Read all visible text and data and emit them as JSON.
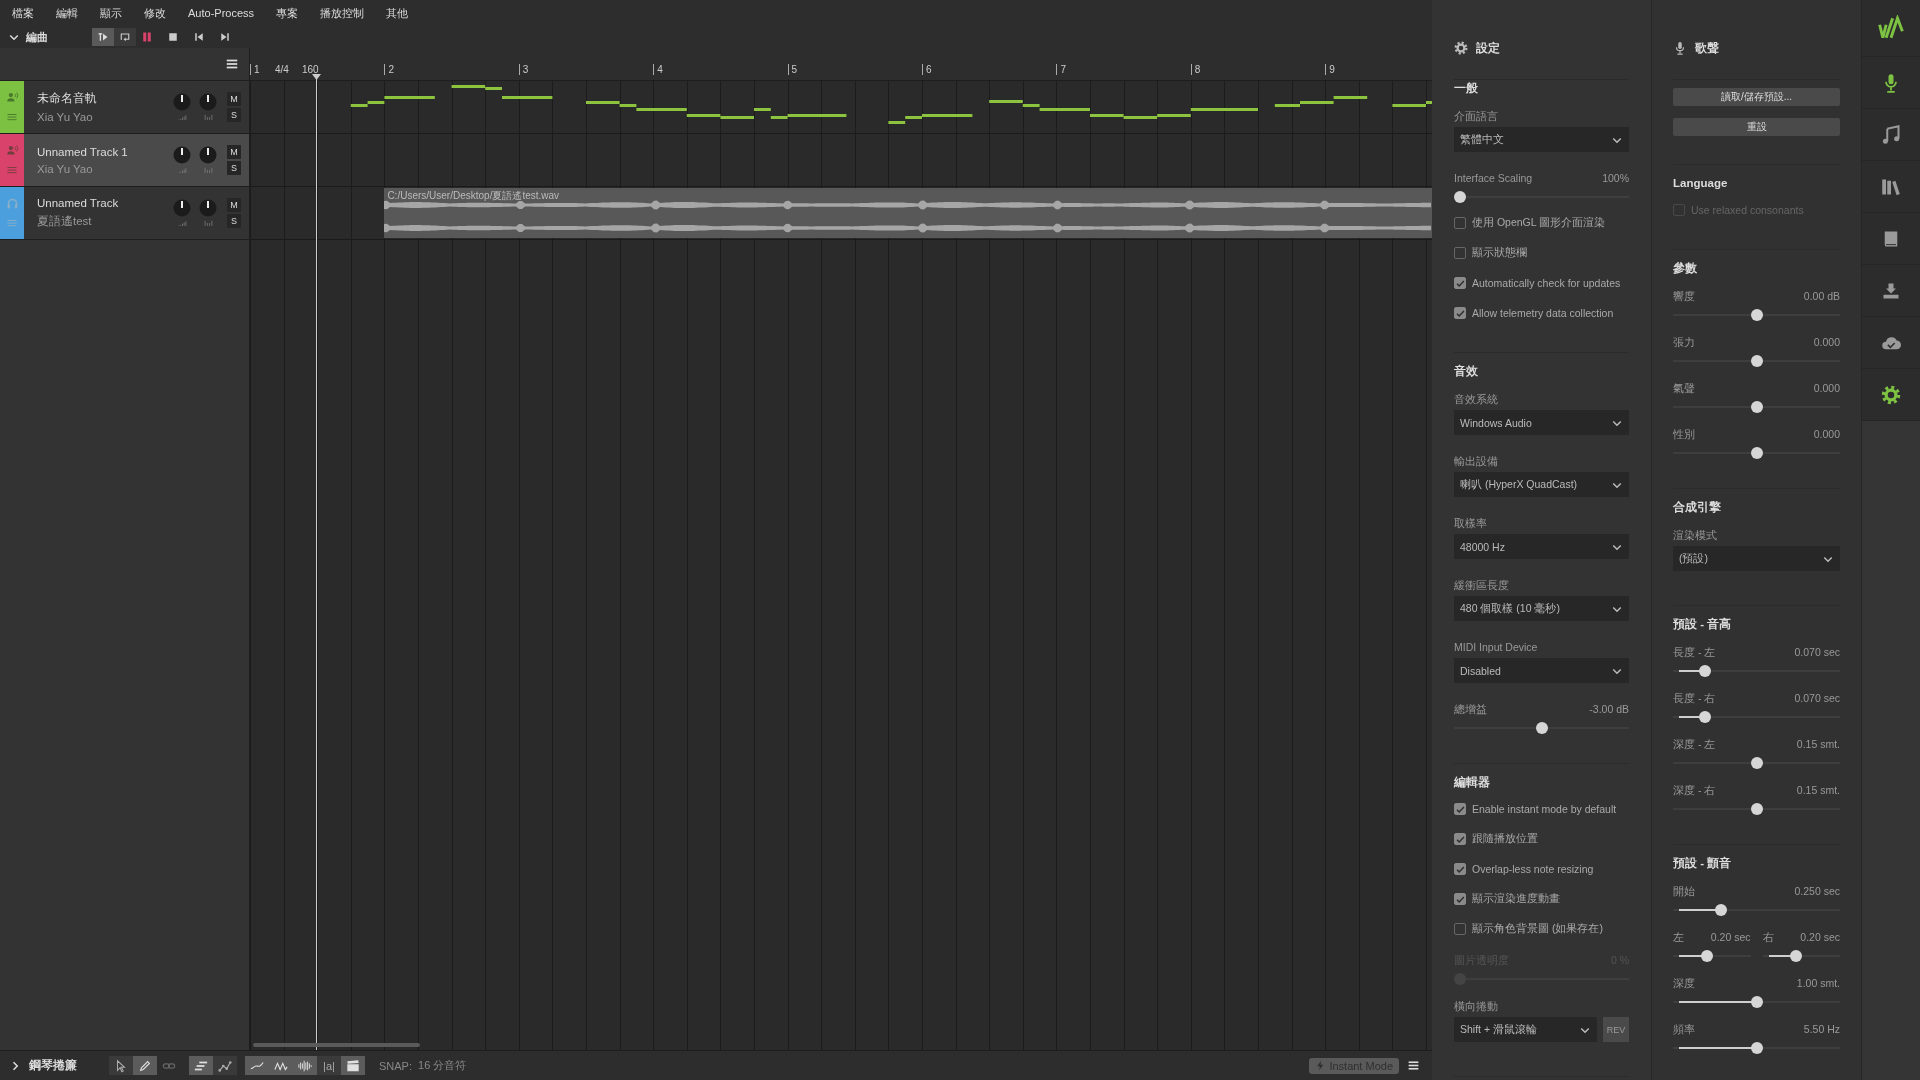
{
  "menu": [
    "檔案",
    "編輯",
    "顯示",
    "修改",
    "Auto-Process",
    "專案",
    "播放控制",
    "其他"
  ],
  "arrangement": {
    "title": "編曲",
    "expanded": true,
    "transport": [
      {
        "kind": "follow",
        "on": true
      },
      {
        "kind": "loop",
        "on": false
      },
      {
        "kind": "record"
      },
      {
        "kind": "stop"
      },
      {
        "kind": "previous"
      },
      {
        "kind": "next"
      }
    ]
  },
  "tracks": [
    {
      "name": "未命名音軌",
      "singer": "Xia Yu Yao",
      "kind": "vocal",
      "color": "#7cc142",
      "selected": false,
      "mute": "M",
      "solo": "S"
    },
    {
      "name": "Unnamed Track 1",
      "singer": "Xia Yu Yao",
      "kind": "vocal",
      "color": "#d9426a",
      "selected": true,
      "mute": "M",
      "solo": "S"
    },
    {
      "name": "Unnamed Track",
      "singer": "夏語遙test",
      "kind": "audio",
      "color": "#4a9fdc",
      "selected": false,
      "mute": "M",
      "solo": "S",
      "clip": {
        "path": "C:/Users/User/Desktop/夏語遙test.wav"
      }
    }
  ],
  "ruler": {
    "bars": [
      "1",
      "2",
      "3",
      "4",
      "5",
      "6",
      "7",
      "8",
      "9"
    ],
    "time_signature": "4/4",
    "tempo": "160"
  },
  "piano_roll": {
    "title": "鋼琴捲簾",
    "expanded": false,
    "tool_groups": [
      [
        {
          "kind": "pointer",
          "on": false
        },
        {
          "kind": "pen",
          "on": true
        },
        {
          "kind": "link",
          "on": false
        }
      ],
      [
        {
          "kind": "align",
          "on": true
        },
        {
          "kind": "curve",
          "on": false
        }
      ],
      [
        {
          "kind": "pitch",
          "on": true
        },
        {
          "kind": "vibrato",
          "on": true
        },
        {
          "kind": "waveform",
          "on": true
        },
        {
          "kind": "lyrics",
          "label": "|a|",
          "on": false
        },
        {
          "kind": "clapper",
          "on": true
        }
      ]
    ],
    "snap_label": "SNAP:",
    "snap_value": "16 分音符",
    "instant_mode": "Instant Mode"
  },
  "settings": {
    "title": "設定",
    "sections": [
      {
        "heading": "一般",
        "items": [
          {
            "kind": "dropdown",
            "label": "介面語言",
            "value": "繁體中文"
          },
          {
            "kind": "slider",
            "label": "Interface Scaling",
            "reading": "100%",
            "level": 0,
            "disabled": false
          },
          {
            "kind": "checkbox",
            "label": "使用 OpenGL 圖形介面渲染",
            "checked": false,
            "disabled": false
          },
          {
            "kind": "checkbox",
            "label": "顯示狀態欄",
            "checked": false,
            "disabled": false
          },
          {
            "kind": "checkbox",
            "label": "Automatically check for updates",
            "checked": true,
            "disabled": false
          },
          {
            "kind": "checkbox",
            "label": "Allow telemetry data collection",
            "checked": true,
            "disabled": false
          }
        ]
      },
      {
        "heading": "音效",
        "items": [
          {
            "kind": "dropdown",
            "label": "音效系統",
            "value": "Windows Audio"
          },
          {
            "kind": "dropdown",
            "label": "輸出設備",
            "value": "喇叭 (HyperX QuadCast)"
          },
          {
            "kind": "dropdown",
            "label": "取樣率",
            "value": "48000 Hz"
          },
          {
            "kind": "dropdown",
            "label": "緩衝區長度",
            "value": "480 個取樣 (10 毫秒)"
          },
          {
            "kind": "dropdown",
            "label": "MIDI Input Device",
            "value": "Disabled"
          },
          {
            "kind": "bipolar",
            "label": "總增益",
            "reading": "-3.00 dB",
            "level": 0.5,
            "disabled": false
          }
        ]
      },
      {
        "heading": "編輯器",
        "items": [
          {
            "kind": "checkbox",
            "label": "Enable instant mode by default",
            "checked": true,
            "disabled": false
          },
          {
            "kind": "checkbox",
            "label": "跟隨播放位置",
            "checked": true,
            "disabled": false
          },
          {
            "kind": "checkbox",
            "label": "Overlap-less note resizing",
            "checked": true,
            "disabled": false
          },
          {
            "kind": "checkbox",
            "label": "顯示渲染進度動畫",
            "checked": true,
            "disabled": false
          },
          {
            "kind": "checkbox",
            "label": "顯示角色背景圖 (如果存在)",
            "checked": false,
            "disabled": false
          },
          {
            "kind": "slider",
            "label": "圖片透明度",
            "reading": "0 %",
            "level": 0,
            "disabled": true
          },
          {
            "kind": "dropdown",
            "label": "橫向捲動",
            "value": "Shift + 滑鼠滾輪",
            "button": "REV"
          }
        ]
      }
    ]
  },
  "singer": {
    "title": "歌聲",
    "sections": [
      {
        "items": [
          {
            "kind": "button",
            "label": "讀取/儲存預設..."
          },
          {
            "kind": "button",
            "label": "重設"
          }
        ]
      },
      {
        "heading": "Language",
        "items": [
          {
            "kind": "checkbox",
            "label": "Use relaxed consonants",
            "checked": false,
            "disabled": true
          }
        ]
      },
      {
        "heading": "參數",
        "items": [
          {
            "kind": "bipolar",
            "label": "響度",
            "reading": "0.00 dB",
            "level": 0.5,
            "disabled": false
          },
          {
            "kind": "bipolar",
            "label": "張力",
            "reading": "0.000",
            "level": 0.5,
            "disabled": false
          },
          {
            "kind": "bipolar",
            "label": "氣聲",
            "reading": "0.000",
            "level": 0.5,
            "disabled": false
          },
          {
            "kind": "bipolar",
            "label": "性別",
            "reading": "0.000",
            "level": 0.5,
            "disabled": false
          }
        ]
      },
      {
        "heading": "合成引擎",
        "items": [
          {
            "kind": "dropdown",
            "label": "渲染模式",
            "value": "(預設)"
          }
        ]
      },
      {
        "heading": "預設 - 音高",
        "items": [
          {
            "kind": "slider",
            "label": "長度 - 左",
            "reading": "0.070 sec",
            "level": 0.17,
            "disabled": false
          },
          {
            "kind": "slider",
            "label": "長度 - 右",
            "reading": "0.070 sec",
            "level": 0.17,
            "disabled": false
          },
          {
            "kind": "bipolar",
            "label": "深度 - 左",
            "reading": "0.15 smt.",
            "level": 0.5,
            "disabled": false
          },
          {
            "kind": "bipolar",
            "label": "深度 - 右",
            "reading": "0.15 smt.",
            "level": 0.5,
            "disabled": false
          }
        ]
      },
      {
        "heading": "預設 - 顫音",
        "items": [
          {
            "kind": "slider",
            "label": "開始",
            "reading": "0.250 sec",
            "level": 0.27,
            "disabled": false
          },
          {
            "kind": "pair",
            "items": [
              {
                "kind": "slider",
                "label": "左",
                "reading": "0.20 sec",
                "level": 0.42,
                "disabled": false
              },
              {
                "kind": "slider",
                "label": "右",
                "reading": "0.20 sec",
                "level": 0.42,
                "disabled": false
              }
            ]
          },
          {
            "kind": "slider",
            "label": "深度",
            "reading": "1.00 smt.",
            "level": 0.5,
            "disabled": false
          },
          {
            "kind": "slider",
            "label": "頻率",
            "reading": "5.50 Hz",
            "level": 0.5,
            "disabled": false
          }
        ]
      }
    ]
  },
  "side_bar": {
    "icons": [
      {
        "kind": "logo"
      },
      {
        "kind": "mic",
        "selected": true
      },
      {
        "kind": "note",
        "selected": false
      },
      {
        "kind": "library",
        "selected": false
      },
      {
        "kind": "book",
        "selected": false
      },
      {
        "kind": "import",
        "selected": false
      },
      {
        "kind": "cloud",
        "selected": false
      },
      {
        "kind": "gear",
        "selected": true
      }
    ]
  }
}
